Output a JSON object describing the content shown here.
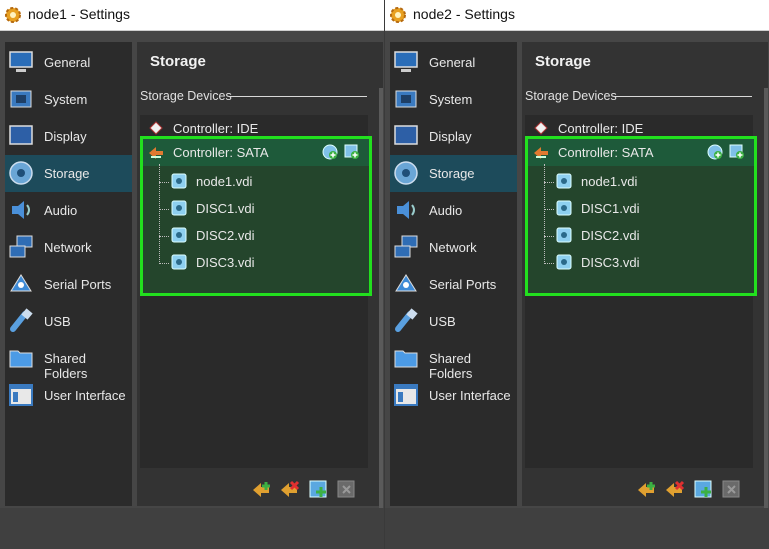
{
  "windows": [
    {
      "title": "node1 - Settings",
      "sidebar": [
        {
          "label": "General",
          "icon": "monitor-icon"
        },
        {
          "label": "System",
          "icon": "chip-icon"
        },
        {
          "label": "Display",
          "icon": "display-icon"
        },
        {
          "label": "Storage",
          "icon": "disk-icon",
          "active": true
        },
        {
          "label": "Audio",
          "icon": "speaker-icon"
        },
        {
          "label": "Network",
          "icon": "network-icon"
        },
        {
          "label": "Serial Ports",
          "icon": "serial-icon"
        },
        {
          "label": "USB",
          "icon": "usb-icon"
        },
        {
          "label": "Shared Folders",
          "icon": "folder-icon"
        },
        {
          "label": "User Interface",
          "icon": "window-icon"
        }
      ],
      "main_title": "Storage",
      "devices_label": "Storage Devices",
      "controllers": [
        {
          "label": "Controller: IDE",
          "icon": "ide-controller-icon"
        },
        {
          "label": "Controller: SATA",
          "icon": "sata-controller-icon"
        }
      ],
      "disks": [
        "node1.vdi",
        "DISC1.vdi",
        "DISC2.vdi",
        "DISC3.vdi"
      ]
    },
    {
      "title": "node2 - Settings",
      "sidebar": [
        {
          "label": "General",
          "icon": "monitor-icon"
        },
        {
          "label": "System",
          "icon": "chip-icon"
        },
        {
          "label": "Display",
          "icon": "display-icon"
        },
        {
          "label": "Storage",
          "icon": "disk-icon",
          "active": true
        },
        {
          "label": "Audio",
          "icon": "speaker-icon"
        },
        {
          "label": "Network",
          "icon": "network-icon"
        },
        {
          "label": "Serial Ports",
          "icon": "serial-icon"
        },
        {
          "label": "USB",
          "icon": "usb-icon"
        },
        {
          "label": "Shared Folders",
          "icon": "folder-icon"
        },
        {
          "label": "User Interface",
          "icon": "window-icon"
        }
      ],
      "main_title": "Storage",
      "devices_label": "Storage Devices",
      "controllers": [
        {
          "label": "Controller: IDE",
          "icon": "ide-controller-icon"
        },
        {
          "label": "Controller: SATA",
          "icon": "sata-controller-icon"
        }
      ],
      "disks": [
        "node1.vdi",
        "DISC1.vdi",
        "DISC2.vdi",
        "DISC3.vdi"
      ]
    }
  ],
  "colors": {
    "highlight_border": "#22e01e",
    "active_sidebar": "#1d4b5b",
    "sata_row": "#1e5a3a"
  }
}
